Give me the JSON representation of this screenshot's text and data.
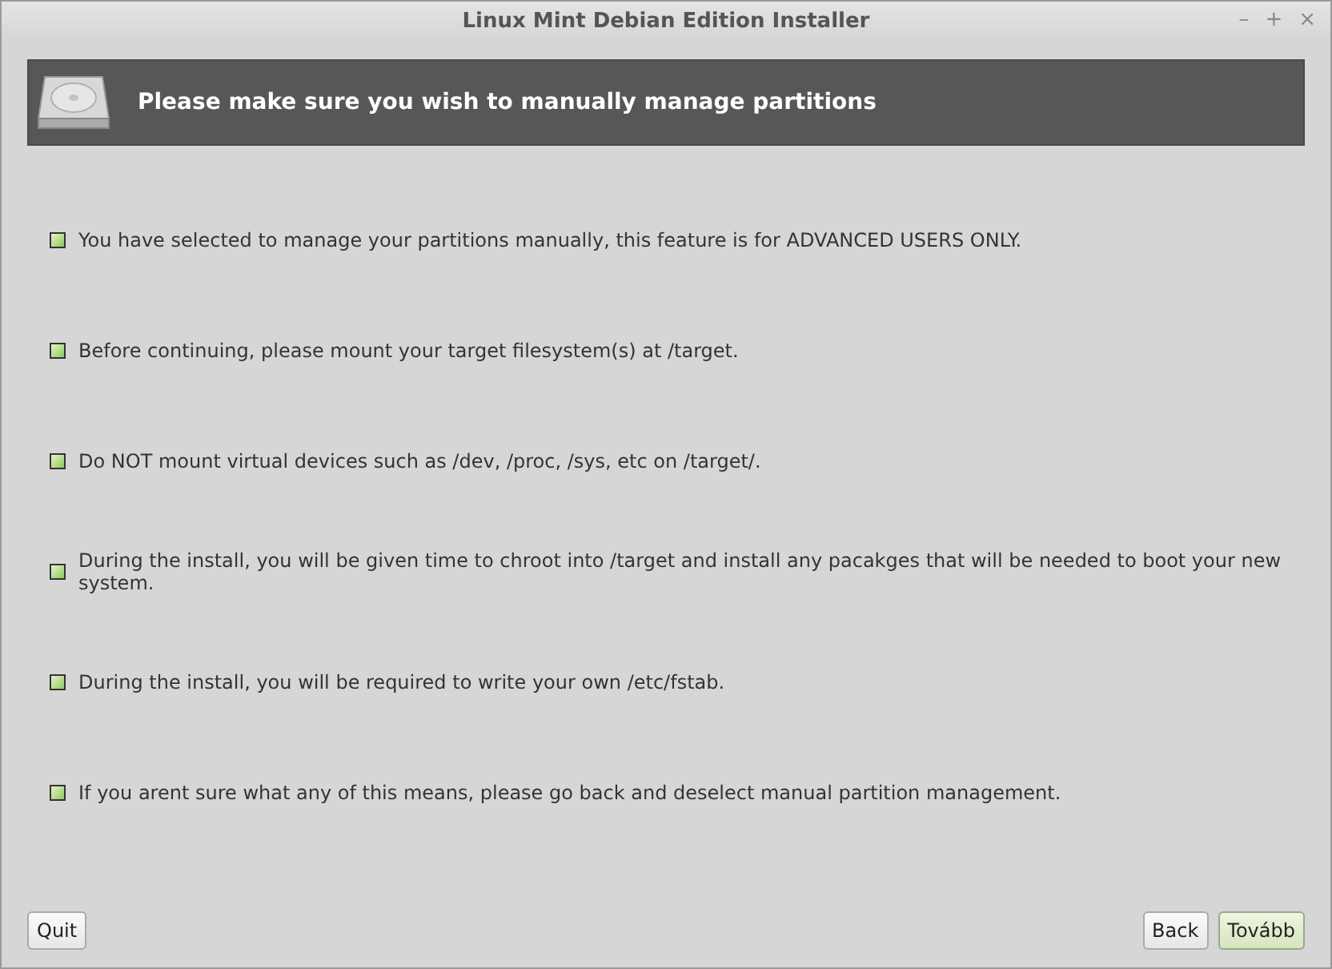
{
  "window": {
    "title": "Linux Mint Debian Edition Installer",
    "controls": [
      "–",
      "+",
      "×"
    ]
  },
  "header": {
    "title": "Please make sure you wish to manually manage partitions"
  },
  "notes": [
    "You have selected to manage your partitions manually, this feature is for ADVANCED USERS ONLY.",
    "Before continuing, please mount your target filesystem(s) at /target.",
    "Do NOT mount virtual devices such as /dev, /proc, /sys, etc on /target/.",
    "During the install, you will be given time to chroot into /target and install any pacakges that will be needed to boot your new system.",
    "During the install, you will be required to write your own /etc/fstab.",
    "If you arent sure what any of this means, please go back and deselect manual partition management."
  ],
  "buttons_left": [
    {
      "label": "Quit",
      "default": false
    }
  ],
  "buttons_right": [
    {
      "label": "Back",
      "default": false
    },
    {
      "label": "Tovább",
      "default": true
    }
  ]
}
